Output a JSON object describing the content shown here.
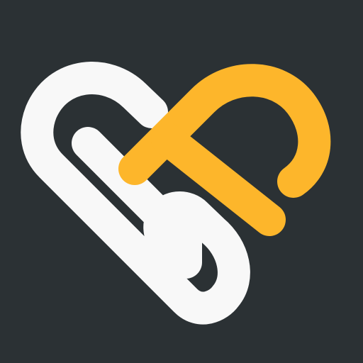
{
  "icon": {
    "name": "heart-monogram-logo",
    "colors": {
      "background": "#2b3134",
      "left_stroke": "#f8f8f8",
      "right_stroke": "#fdb62b"
    }
  }
}
